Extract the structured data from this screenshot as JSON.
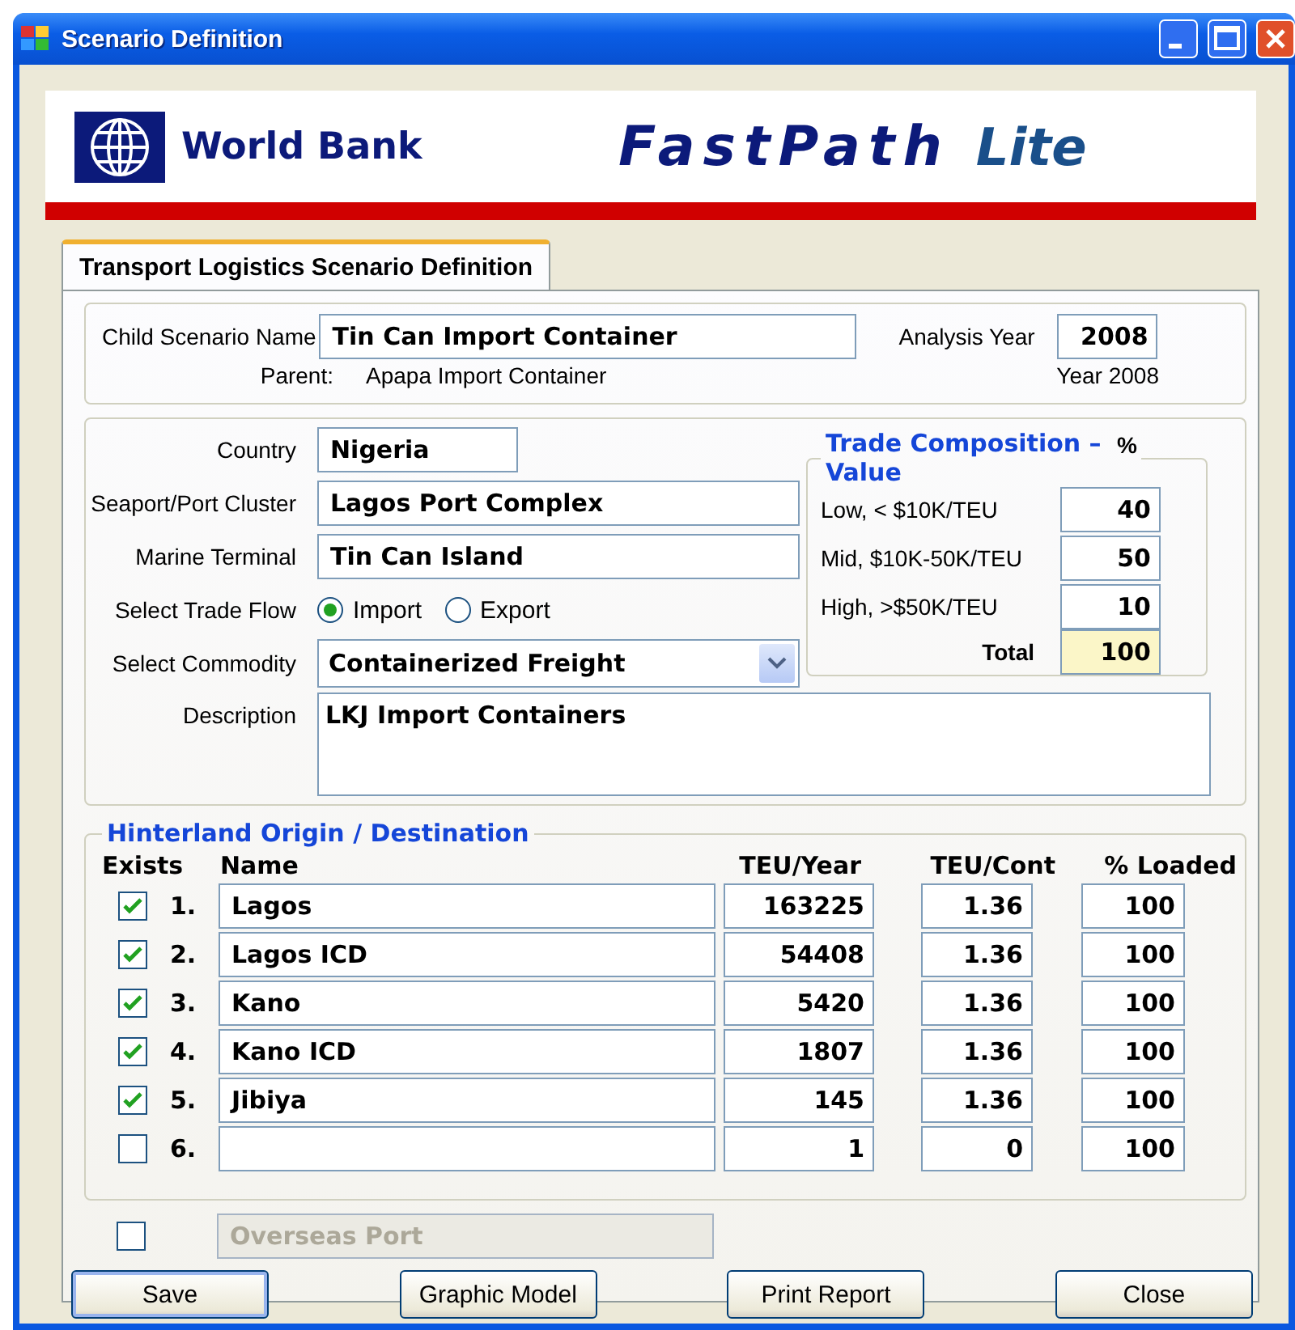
{
  "window": {
    "title": "Scenario Definition"
  },
  "banner": {
    "org": "World Bank",
    "product": "FastPath",
    "edition": "Lite"
  },
  "tabs": [
    {
      "label": "Transport Logistics Scenario Definition",
      "selected": true
    }
  ],
  "scenario": {
    "name_label": "Child Scenario Name",
    "name": "Tin Can Import Container",
    "year_label": "Analysis Year",
    "year": "2008",
    "parent_label": "Parent:",
    "parent": "Apapa Import Container",
    "parent_year": "Year 2008"
  },
  "fields": [
    {
      "label": "Country",
      "value": "Nigeria",
      "kind": "short"
    },
    {
      "label": "Seaport/Port Cluster",
      "value": "Lagos Port Complex",
      "kind": "long"
    },
    {
      "label": "Marine Terminal",
      "value": "Tin Can Island",
      "kind": "long"
    }
  ],
  "trade_flow": {
    "label": "Select Trade Flow",
    "options": [
      {
        "label": "Import",
        "selected": true
      },
      {
        "label": "Export",
        "selected": false
      }
    ]
  },
  "commodity": {
    "label": "Select Commodity",
    "value": "Containerized Freight"
  },
  "description": {
    "label": "Description",
    "value": "LKJ Import Containers"
  },
  "trade_composition": {
    "title": "Trade Composition – Value",
    "unit": "%",
    "rows": [
      {
        "label": "Low, < $10K/TEU",
        "value": "40"
      },
      {
        "label": "Mid, $10K-50K/TEU",
        "value": "50"
      },
      {
        "label": "High, >$50K/TEU",
        "value": "10"
      }
    ],
    "total_label": "Total",
    "total": "100"
  },
  "hinterland": {
    "title": "Hinterland Origin / Destination",
    "columns": [
      "Exists",
      "Name",
      "TEU/Year",
      "TEU/Cont",
      "% Loaded"
    ],
    "rows": [
      {
        "checked": true,
        "number": "1.",
        "name": "Lagos",
        "teu_year": "163225",
        "teu_cont": "1.36",
        "loaded": "100"
      },
      {
        "checked": true,
        "number": "2.",
        "name": "Lagos ICD",
        "teu_year": "54408",
        "teu_cont": "1.36",
        "loaded": "100"
      },
      {
        "checked": true,
        "number": "3.",
        "name": "Kano",
        "teu_year": "5420",
        "teu_cont": "1.36",
        "loaded": "100"
      },
      {
        "checked": true,
        "number": "4.",
        "name": "Kano ICD",
        "teu_year": "1807",
        "teu_cont": "1.36",
        "loaded": "100"
      },
      {
        "checked": true,
        "number": "5.",
        "name": "Jibiya",
        "teu_year": "145",
        "teu_cont": "1.36",
        "loaded": "100"
      },
      {
        "checked": false,
        "number": "6.",
        "name": "",
        "teu_year": "1",
        "teu_cont": "0",
        "loaded": "100"
      }
    ]
  },
  "overseas": {
    "checked": false,
    "placeholder": "Overseas Port",
    "disabled": true
  },
  "buttons": [
    {
      "label": "Save",
      "default": true
    },
    {
      "label": "Graphic Model",
      "default": false
    },
    {
      "label": "Print Report",
      "default": false
    },
    {
      "label": "Close",
      "default": false
    }
  ]
}
